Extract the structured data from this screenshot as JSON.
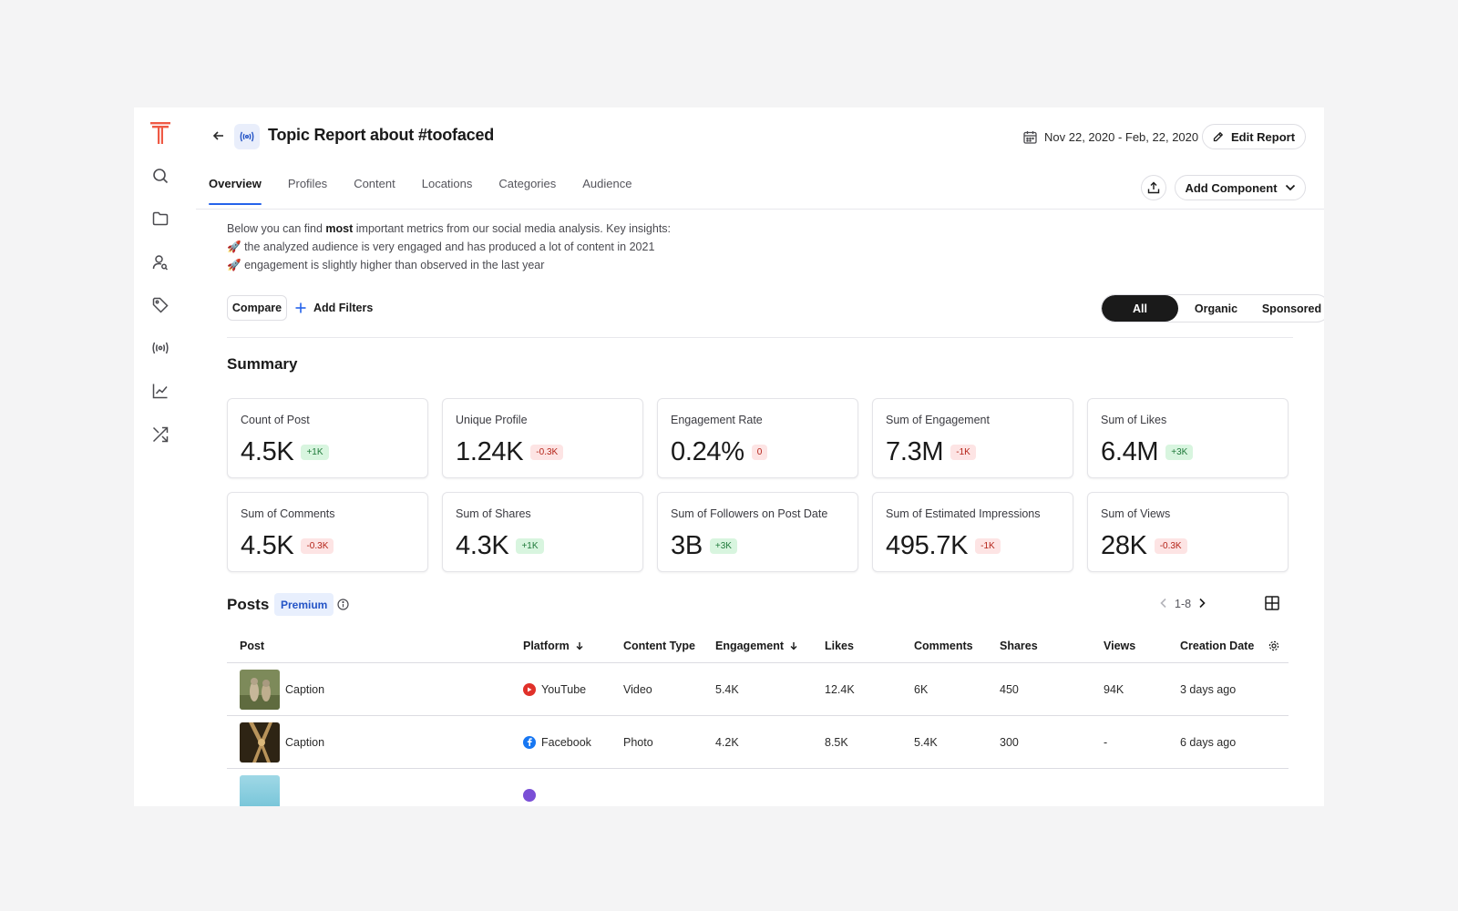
{
  "header": {
    "title": "Topic Report about #toofaced",
    "date_range": "Nov 22, 2020 - Feb, 22, 2020",
    "edit_report": "Edit Report",
    "add_component": "Add Component"
  },
  "sidebar": {
    "items": [
      {
        "icon": "search-icon"
      },
      {
        "icon": "folder-icon"
      },
      {
        "icon": "user-search-icon"
      },
      {
        "icon": "tag-icon"
      },
      {
        "icon": "broadcast-icon"
      },
      {
        "icon": "chart-line-icon"
      },
      {
        "icon": "shuffle-icon"
      }
    ]
  },
  "tabs": [
    {
      "label": "Overview",
      "active": true
    },
    {
      "label": "Profiles"
    },
    {
      "label": "Content"
    },
    {
      "label": "Locations"
    },
    {
      "label": "Categories"
    },
    {
      "label": "Audience"
    }
  ],
  "insights": {
    "line1_pre": "Below you can find ",
    "line1_bold": "most",
    "line1_post": " important metrics from our social media analysis.  Key insights:",
    "bullet_emoji": "🚀",
    "bullets": [
      "the analyzed audience is very engaged and has produced a lot of content in 2021",
      "engagement is slightly higher than observed in the last year"
    ]
  },
  "filters": {
    "compare": "Compare",
    "add_filters": "Add Filters",
    "segments": [
      "All",
      "Organic",
      "Sponsored"
    ],
    "active_segment": "All"
  },
  "summary": {
    "title": "Summary",
    "cards": [
      {
        "label": "Count of Post",
        "value": "4.5K",
        "delta": "+1K",
        "trend": "pos"
      },
      {
        "label": "Unique Profile",
        "value": "1.24K",
        "delta": "-0.3K",
        "trend": "neg"
      },
      {
        "label": "Engagement Rate",
        "value": "0.24%",
        "delta": "0",
        "trend": "neg"
      },
      {
        "label": "Sum of Engagement",
        "value": "7.3M",
        "delta": "-1K",
        "trend": "neg"
      },
      {
        "label": "Sum of Likes",
        "value": "6.4M",
        "delta": "+3K",
        "trend": "pos"
      },
      {
        "label": "Sum of Comments",
        "value": "4.5K",
        "delta": "-0.3K",
        "trend": "neg"
      },
      {
        "label": "Sum of Shares",
        "value": "4.3K",
        "delta": "+1K",
        "trend": "pos"
      },
      {
        "label": "Sum of Followers on Post Date",
        "value": "3B",
        "delta": "+3K",
        "trend": "pos"
      },
      {
        "label": "Sum of Estimated Impressions",
        "value": "495.7K",
        "delta": "-1K",
        "trend": "neg"
      },
      {
        "label": "Sum of Views",
        "value": "28K",
        "delta": "-0.3K",
        "trend": "neg"
      }
    ]
  },
  "posts": {
    "title": "Posts",
    "badge": "Premium",
    "pager": "1-8",
    "columns": [
      "Post",
      "Platform",
      "Content Type",
      "Engagement",
      "Likes",
      "Comments",
      "Shares",
      "Views",
      "Creation Date"
    ],
    "rows": [
      {
        "caption": "Caption",
        "platform": "YouTube",
        "platform_color": "#e0312a",
        "content_type": "Video",
        "engagement": "5.4K",
        "likes": "12.4K",
        "comments": "6K",
        "shares": "450",
        "views": "94K",
        "created": "3 days ago"
      },
      {
        "caption": "Caption",
        "platform": "Facebook",
        "platform_color": "#1877f2",
        "content_type": "Photo",
        "engagement": "4.2K",
        "likes": "8.5K",
        "comments": "5.4K",
        "shares": "300",
        "views": "-",
        "created": "6 days ago"
      }
    ]
  },
  "colors": {
    "accent": "#2563eb",
    "logo": "#ef5a45",
    "positive": "#1f7a3a",
    "negative": "#b42318"
  }
}
